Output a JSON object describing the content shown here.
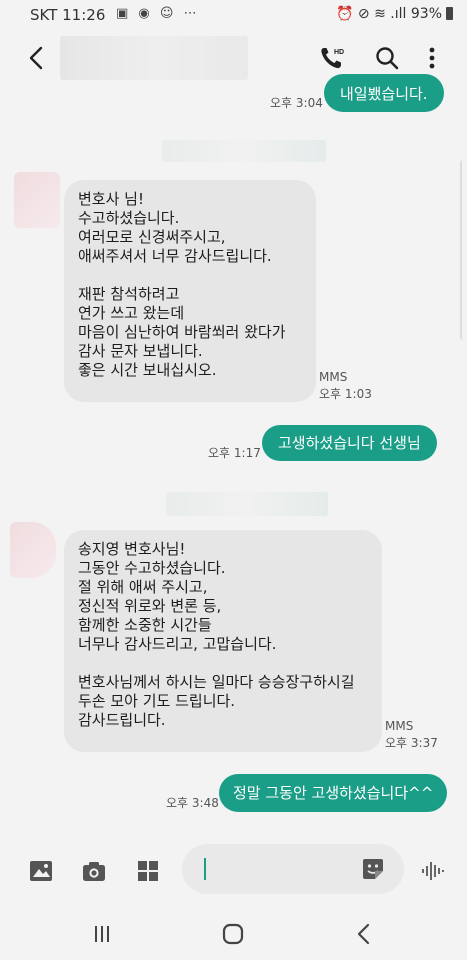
{
  "status_bar": {
    "carrier": "SKT",
    "time": "11:26",
    "notification_icons": "▣ ◉ ☺ ⋯",
    "system_icons": "⏰ ⊘ ≋ .ıll",
    "battery": "93%"
  },
  "header": {
    "contact_name_hidden": true,
    "hd_badge": "HD"
  },
  "messages": {
    "top_partial": {
      "text": "내일뵀습니다.",
      "time": "오후 3:04"
    },
    "incoming_1": {
      "text": "변호사 님!\n수고하셨습니다.\n여러모로 신경써주시고,\n애써주셔서 너무 감사드립니다.\n\n재판 참석하려고\n연가 쓰고 왔는데\n마음이 심난하여 바람쐬러 왔다가\n감사 문자 보냅니다.\n좋은 시간 보내십시오.",
      "type": "MMS",
      "time": "오후 1:03"
    },
    "outgoing_1": {
      "text": "고생하셨습니다 선생님",
      "time": "오후 1:17"
    },
    "incoming_2": {
      "text": "송지영 변호사님!\n그동안 수고하셨습니다.\n절 위해 애써 주시고,\n정신적 위로와 변론 등,\n함께한 소중한 시간들\n너무나 감사드리고, 고맙습니다.\n\n변호사님께서 하시는 일마다 승승장구하시길\n두손 모아 기도 드립니다.\n감사드립니다.",
      "type": "MMS",
      "time": "오후 3:37"
    },
    "outgoing_2": {
      "text": "정말 그동안 고생하셨습니다^^",
      "time": "오후 3:48"
    }
  },
  "composer": {
    "placeholder": ""
  },
  "colors": {
    "accent": "#1b9e87",
    "incoming_bubble": "#e6e6e6",
    "background": "#f3f3f3"
  },
  "icons": [
    "back-arrow-icon",
    "hd-call-icon",
    "search-icon",
    "more-vert-icon",
    "gallery-icon",
    "camera-icon",
    "apps-grid-icon",
    "sticker-icon",
    "voice-icon",
    "recents-icon",
    "home-icon",
    "back-nav-icon"
  ]
}
